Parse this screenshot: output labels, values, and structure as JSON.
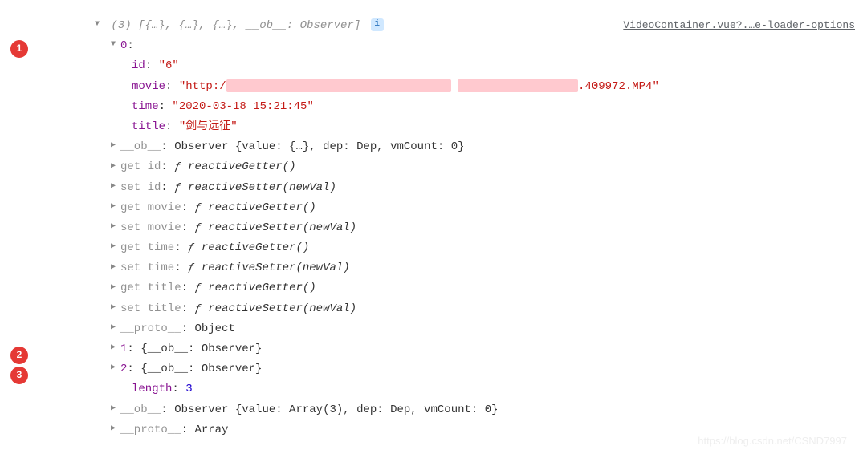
{
  "sourceLink": "VideoContainer.vue?.…e-loader-options",
  "annotations": {
    "a1": "1",
    "a2": "2",
    "a3": "3"
  },
  "summary": "(3) [{…}, {…}, {…}, __ob__: Observer]",
  "infoBadge": "i",
  "item0": {
    "key": "0",
    "id": {
      "k": "id",
      "v": "\"6\""
    },
    "movie": {
      "k": "movie",
      "pre": "\"http:/",
      "post": ".409972.MP4\""
    },
    "time": {
      "k": "time",
      "v": "\"2020-03-18 15:21:45\""
    },
    "title": {
      "k": "title",
      "v": "\"剑与远征\""
    },
    "ob": {
      "k": "__ob__",
      "v": "Observer {value: {…}, dep: Dep, vmCount: 0}"
    },
    "getId": {
      "k": "get id",
      "v": "reactiveGetter()"
    },
    "setId": {
      "k": "set id",
      "v": "reactiveSetter(newVal)"
    },
    "getMovie": {
      "k": "get movie",
      "v": "reactiveGetter()"
    },
    "setMovie": {
      "k": "set movie",
      "v": "reactiveSetter(newVal)"
    },
    "getTime": {
      "k": "get time",
      "v": "reactiveGetter()"
    },
    "setTime": {
      "k": "set time",
      "v": "reactiveSetter(newVal)"
    },
    "getTitle": {
      "k": "get title",
      "v": "reactiveGetter()"
    },
    "setTitle": {
      "k": "set title",
      "v": "reactiveSetter(newVal)"
    },
    "proto": {
      "k": "__proto__",
      "v": "Object"
    }
  },
  "item1": {
    "k": "1",
    "v": "{__ob__: Observer}"
  },
  "item2": {
    "k": "2",
    "v": "{__ob__: Observer}"
  },
  "length": {
    "k": "length",
    "v": "3"
  },
  "arrOb": {
    "k": "__ob__",
    "v": "Observer {value: Array(3), dep: Dep, vmCount: 0}"
  },
  "arrProto": {
    "k": "__proto__",
    "v": "Array"
  },
  "fSym": "ƒ ",
  "watermark": "https://blog.csdn.net/CSND7997"
}
